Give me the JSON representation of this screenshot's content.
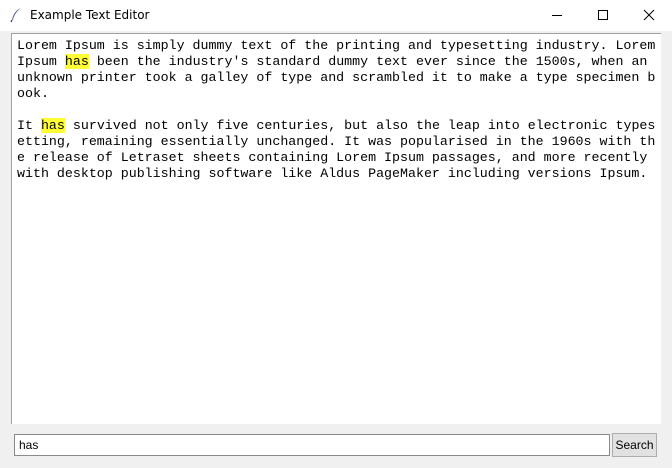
{
  "window": {
    "title": "Example Text Editor",
    "icon": "feather-icon",
    "controls": [
      "minimize-icon",
      "maximize-icon",
      "close-icon"
    ]
  },
  "editor": {
    "highlight_color": "#ffff33",
    "lines": [
      [
        {
          "t": "Lorem Ipsum is simply dummy text of the printing and typesetting industry. Lorem"
        }
      ],
      [
        {
          "t": "Ipsum "
        },
        {
          "t": "has",
          "hl": true
        },
        {
          "t": " been the industry's standard dummy text ever since the 1500s, when an"
        }
      ],
      [
        {
          "t": "unknown printer took a galley of type and scrambled it to make a type specimen b"
        }
      ],
      [
        {
          "t": "ook."
        }
      ],
      [
        {
          "t": ""
        }
      ],
      [
        {
          "t": "It "
        },
        {
          "t": "has",
          "hl": true
        },
        {
          "t": " survived not only five centuries, but also the leap into electronic types"
        }
      ],
      [
        {
          "t": "etting, remaining essentially unchanged. It was popularised in the 1960s with th"
        }
      ],
      [
        {
          "t": "e release of Letraset sheets containing Lorem Ipsum passages, and more recently"
        }
      ],
      [
        {
          "t": "with desktop publishing software like Aldus PageMaker including versions Ipsum."
        }
      ]
    ]
  },
  "search": {
    "value": "has",
    "button_label": "Search"
  }
}
